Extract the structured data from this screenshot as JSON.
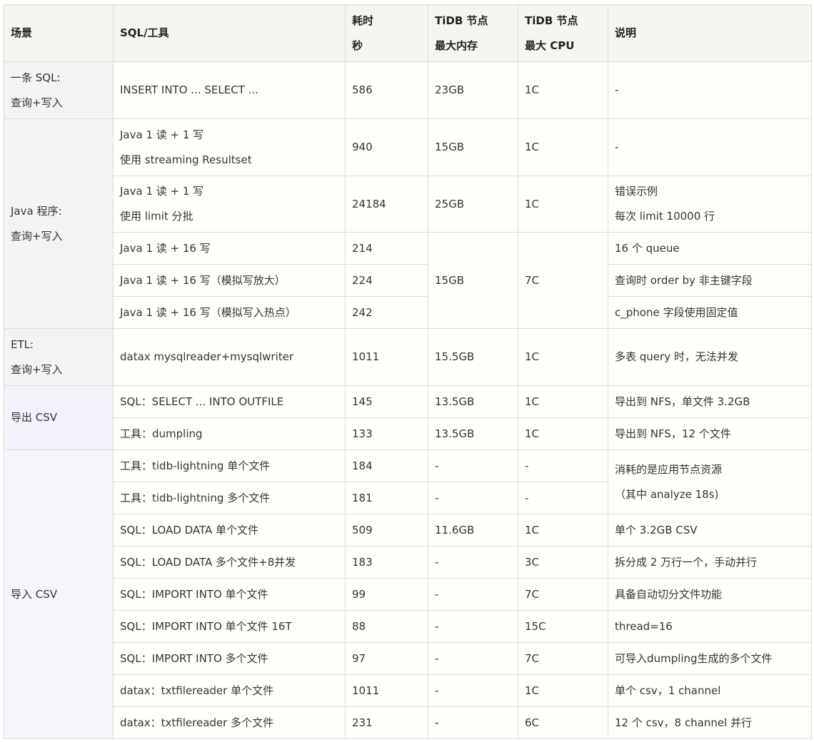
{
  "headers": {
    "scene": "场景",
    "tool": "SQL/工具",
    "time_l1": "耗时",
    "time_l2": "秒",
    "mem_l1": "TiDB 节点",
    "mem_l2": "最大内存",
    "cpu_l1": "TiDB 节点",
    "cpu_l2": "最大 CPU",
    "note": "说明"
  },
  "groups": {
    "sql_scene_l1": "一条 SQL:",
    "sql_scene_l2": "查询+写入",
    "java_scene_l1": "Java 程序:",
    "java_scene_l2": "查询+写入",
    "etl_scene_l1": "ETL:",
    "etl_scene_l2": "查询+写入",
    "export_scene": "导出 CSV",
    "import_scene": "导入 CSV"
  },
  "rows": [
    {
      "tool": "INSERT INTO ... SELECT ...",
      "time": "586",
      "mem": "23GB",
      "cpu": "1C",
      "note": "-"
    },
    {
      "tool_l1": "Java 1 读 + 1 写",
      "tool_l2": "使用 streaming Resultset",
      "time": "940",
      "mem": "15GB",
      "cpu": "1C",
      "note": "-"
    },
    {
      "tool_l1": "Java 1 读 + 1 写",
      "tool_l2": "使用 limit 分批",
      "time": "24184",
      "mem": "25GB",
      "cpu": "1C",
      "note_l1": "错误示例",
      "note_l2": "每次 limit 10000 行"
    },
    {
      "tool": "Java 1 读 + 16 写",
      "time": "214",
      "mem": "15GB",
      "cpu": "7C",
      "note": "16 个 queue"
    },
    {
      "tool": "Java 1 读 + 16 写（模拟写放大）",
      "time": "224",
      "note": "查询时 order by 非主键字段"
    },
    {
      "tool": "Java 1 读 + 16 写（模拟写入热点）",
      "time": "242",
      "note": "c_phone 字段使用固定值"
    },
    {
      "tool": "datax mysqlreader+mysqlwriter",
      "time": "1011",
      "mem": "15.5GB",
      "cpu": "1C",
      "note": "多表 query 时，无法并发"
    },
    {
      "tool": "SQL：SELECT ... INTO OUTFILE",
      "time": "145",
      "mem": "13.5GB",
      "cpu": "1C",
      "note": "导出到 NFS，单文件 3.2GB"
    },
    {
      "tool": "工具：dumpling",
      "time": "133",
      "mem": "13.5GB",
      "cpu": "1C",
      "note": "导出到 NFS，12 个文件"
    },
    {
      "tool": "工具：tidb-lightning 单个文件",
      "time": "184",
      "mem": "-",
      "cpu": "-",
      "note_l1": "消耗的是应用节点资源",
      "note_l2": "（其中 analyze 18s)"
    },
    {
      "tool": "工具：tidb-lightning 多个文件",
      "time": "181",
      "mem": "-",
      "cpu": "-"
    },
    {
      "tool": "SQL：LOAD DATA 单个文件",
      "time": "509",
      "mem": "11.6GB",
      "cpu": "1C",
      "note": "单个 3.2GB CSV"
    },
    {
      "tool": "SQL：LOAD DATA 多个文件+8并发",
      "time": "183",
      "mem": "-",
      "cpu": "3C",
      "note": "拆分成 2 万行一个，手动并行"
    },
    {
      "tool": "SQL：IMPORT INTO 单个文件",
      "time": "99",
      "mem": "-",
      "cpu": "7C",
      "note": "具备自动切分文件功能"
    },
    {
      "tool": "SQL：IMPORT INTO 单个文件 16T",
      "time": "88",
      "mem": "-",
      "cpu": "15C",
      "note": "thread=16"
    },
    {
      "tool": "SQL：IMPORT INTO 多个文件",
      "time": "97",
      "mem": "-",
      "cpu": "7C",
      "note": "可导入dumpling生成的多个文件"
    },
    {
      "tool": "datax：txtfilereader 单个文件",
      "time": "1011",
      "mem": "-",
      "cpu": "1C",
      "note": "单个 csv，1 channel"
    },
    {
      "tool": "datax：txtfilereader 多个文件",
      "time": "231",
      "mem": "-",
      "cpu": "6C",
      "note": "12 个 csv，8 channel 并行"
    }
  ]
}
